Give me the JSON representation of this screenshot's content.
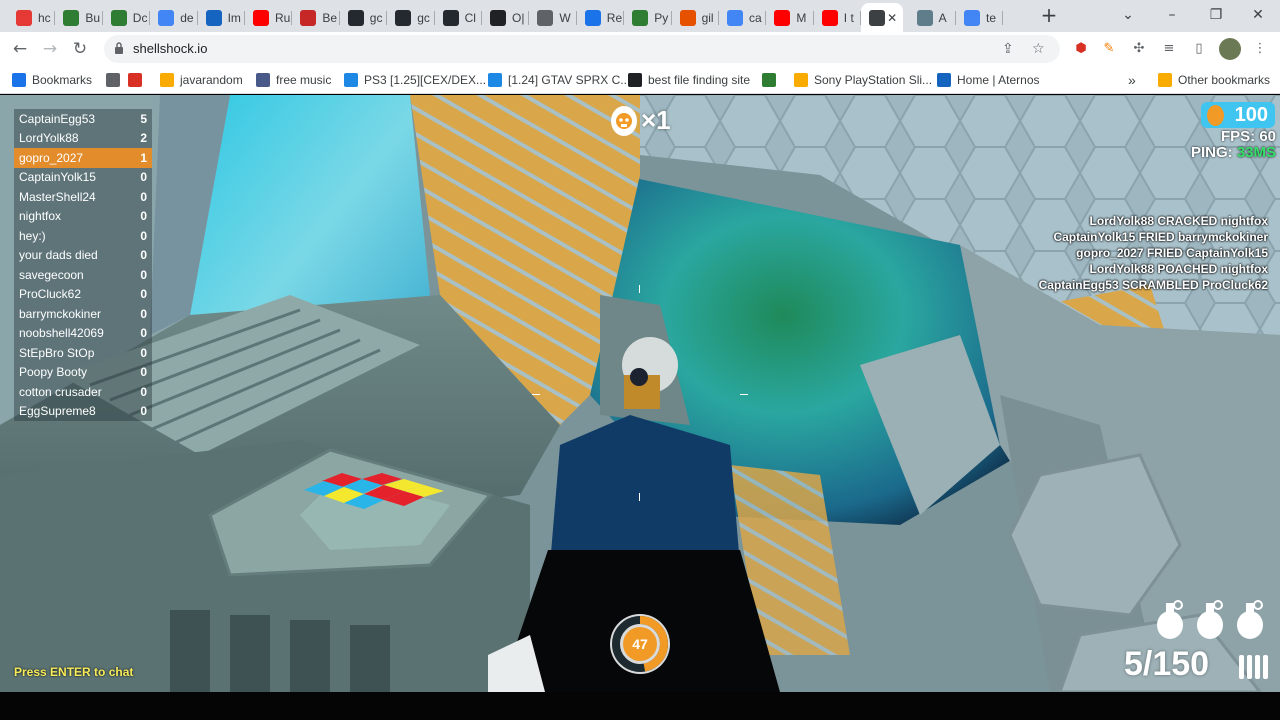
{
  "browser": {
    "tabs": [
      {
        "label": "hc",
        "icon": "multicolor-icon",
        "color": "#e53935"
      },
      {
        "label": "Bu",
        "icon": "game-icon",
        "color": "#2e7d32"
      },
      {
        "label": "Dc",
        "icon": "game-icon",
        "color": "#2e7d32"
      },
      {
        "label": "de",
        "icon": "google-icon",
        "color": "#4285f4"
      },
      {
        "label": "Im",
        "icon": "trend-icon",
        "color": "#1565c0"
      },
      {
        "label": "Ru",
        "icon": "youtube-icon",
        "color": "#ff0000"
      },
      {
        "label": "Be",
        "icon": "m-icon",
        "color": "#c62828"
      },
      {
        "label": "gc",
        "icon": "github-icon",
        "color": "#24292f"
      },
      {
        "label": "gc",
        "icon": "github-icon",
        "color": "#24292f"
      },
      {
        "label": "Cl",
        "icon": "github-icon",
        "color": "#24292f"
      },
      {
        "label": "O|",
        "icon": "openai-icon",
        "color": "#202124"
      },
      {
        "label": "W",
        "icon": "globe-icon",
        "color": "#5f6368"
      },
      {
        "label": "Re",
        "icon": "dot-icon",
        "color": "#1a73e8"
      },
      {
        "label": "Py",
        "icon": "w-icon",
        "color": "#2e7d32"
      },
      {
        "label": "gil",
        "icon": "hand-icon",
        "color": "#e65100"
      },
      {
        "label": "ca",
        "icon": "google-icon",
        "color": "#4285f4"
      },
      {
        "label": "M",
        "icon": "youtube-icon",
        "color": "#ff0000"
      },
      {
        "label": "I t",
        "icon": "youtube-icon",
        "color": "#ff0000"
      },
      {
        "label": "",
        "icon": "speaker-icon",
        "color": "#3c4043",
        "active": true
      },
      {
        "label": "A",
        "icon": "image-icon",
        "color": "#607d8b"
      },
      {
        "label": "te",
        "icon": "google-icon",
        "color": "#4285f4"
      }
    ],
    "url": "shellshock.io",
    "bookmarks": [
      {
        "label": "Bookmarks",
        "color": "#1a73e8"
      },
      {
        "label": "",
        "color": "#5f6368"
      },
      {
        "label": "",
        "color": "#d93025"
      },
      {
        "label": "javarandom",
        "color": "#f9ab00"
      },
      {
        "label": "free music",
        "color": "#4a5a88"
      },
      {
        "label": "PS3 [1.25][CEX/DEX...",
        "color": "#1e88e5"
      },
      {
        "label": "[1.24] GTAV SPRX C...",
        "color": "#1e88e5"
      },
      {
        "label": "best file finding site",
        "color": "#202124"
      },
      {
        "label": "",
        "color": "#2e7d32"
      },
      {
        "label": "Sony PlayStation Sli...",
        "color": "#f9ab00"
      },
      {
        "label": "Home | Aternos",
        "color": "#1565c0"
      },
      {
        "label": "Other bookmarks",
        "color": "#f9ab00"
      }
    ],
    "more_bookmarks": "»"
  },
  "game": {
    "leaderboard": [
      {
        "name": "CaptainEgg53",
        "score": "5"
      },
      {
        "name": "LordYolk88",
        "score": "2"
      },
      {
        "name": "gopro_2027",
        "score": "1",
        "me": true
      },
      {
        "name": "CaptainYolk15",
        "score": "0"
      },
      {
        "name": "MasterShell24",
        "score": "0"
      },
      {
        "name": "nightfox",
        "score": "0"
      },
      {
        "name": "hey:)",
        "score": "0"
      },
      {
        "name": "your dads died",
        "score": "0"
      },
      {
        "name": "savegecoon",
        "score": "0"
      },
      {
        "name": "ProCluck62",
        "score": "0"
      },
      {
        "name": "barrymckokiner",
        "score": "0"
      },
      {
        "name": "noobshell42069",
        "score": "0"
      },
      {
        "name": "StEpBro StOp",
        "score": "0"
      },
      {
        "name": "Poopy Booty",
        "score": "0"
      },
      {
        "name": "cotton crusader",
        "score": "0"
      },
      {
        "name": "EggSupreme8",
        "score": "0"
      }
    ],
    "kill_streak": "×1",
    "eggs": "100",
    "fps_label": "FPS:",
    "fps_value": "60",
    "ping_label": "PING:",
    "ping_value": "33MS",
    "kill_feed": [
      "LordYolk88 CRACKED nightfox",
      "CaptainYolk15 FRIED barrymckokiner",
      "gopro_2027 FRIED CaptainYolk15",
      "LordYolk88 POACHED nightfox",
      "CaptainEgg53 SCRAMBLED ProCluck62"
    ],
    "chat_hint": "Press ENTER to chat",
    "health": "47",
    "health_fraction": 0.47,
    "ammo": "5/150",
    "grenades": 3,
    "colors": {
      "accent": "#e38c2c",
      "badge": "#40c4f0",
      "ping": "#35e06a",
      "chat_hint": "#f7ec5a"
    }
  }
}
